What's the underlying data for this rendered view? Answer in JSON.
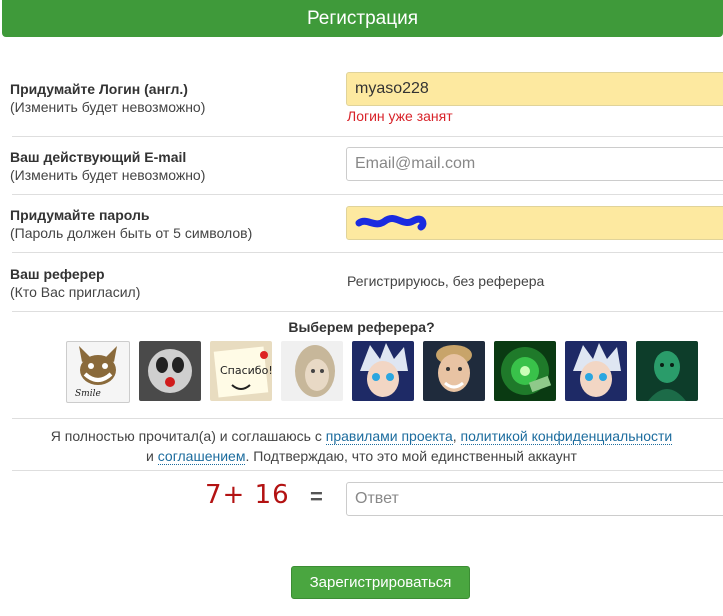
{
  "header": {
    "title": "Регистрация"
  },
  "login": {
    "label": "Придумайте Логин (англ.)",
    "hint": "(Изменить будет невозможно)",
    "value": "myaso228",
    "error": "Логин уже занят"
  },
  "email": {
    "label": "Ваш действующий E-mail",
    "hint": "(Изменить будет невозможно)",
    "placeholder": "Email@mail.com"
  },
  "password": {
    "label": "Придумайте пароль",
    "hint": "(Пароль должен быть от 5 символов)"
  },
  "referrer": {
    "label": "Ваш реферер",
    "hint": "(Кто Вас пригласил)",
    "value": "Регистрируюсь, без реферера",
    "choose_title": "Выберем реферера?",
    "avatars": [
      "cat-avatar",
      "ghost-face-avatar",
      "thanks-note-avatar",
      "blonde-girl-avatar",
      "anime-avatar",
      "young-man-avatar",
      "money-tunnel-avatar",
      "anime-avatar",
      "joker-avatar"
    ],
    "avatar_note_text": "Спасибо!"
  },
  "agreement": {
    "text1": "Я полностью прочитал(а) и соглашаюсь с ",
    "rules_link": "правилами проекта",
    "comma": ", ",
    "policy_link": "политикой конфиденциальности",
    "text2": "и ",
    "agreement_link": "соглашением",
    "text3": ". Подтверждаю, что это мой единственный аккаунт"
  },
  "captcha": {
    "expression": "7+ 16",
    "equals": "=",
    "placeholder": "Ответ"
  },
  "submit": {
    "label": "Зарегистрироваться"
  },
  "colors": {
    "header": "#3f9a3a",
    "button": "#4aa640",
    "error": "#d8232a",
    "link": "#1c6c9e",
    "input_filled": "#fde9a0"
  }
}
